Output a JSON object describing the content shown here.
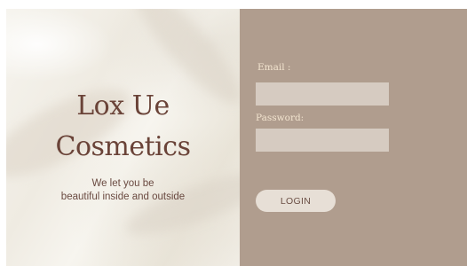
{
  "brand": {
    "line1": "Lox Ue",
    "line2": "Cosmetics",
    "tagline_line1": "We let you be",
    "tagline_line2": "beautiful inside and outside"
  },
  "login": {
    "email_label": "Email :",
    "email_value": "",
    "password_label": "Password:",
    "password_value": "",
    "login_button": "LOGIN"
  },
  "colors": {
    "panel_bg": "#b09d8e",
    "field_bg": "#d6cbc1",
    "brand_text": "#6a4338",
    "label_text": "#f2e4cf",
    "button_bg": "#e7dfd6"
  }
}
